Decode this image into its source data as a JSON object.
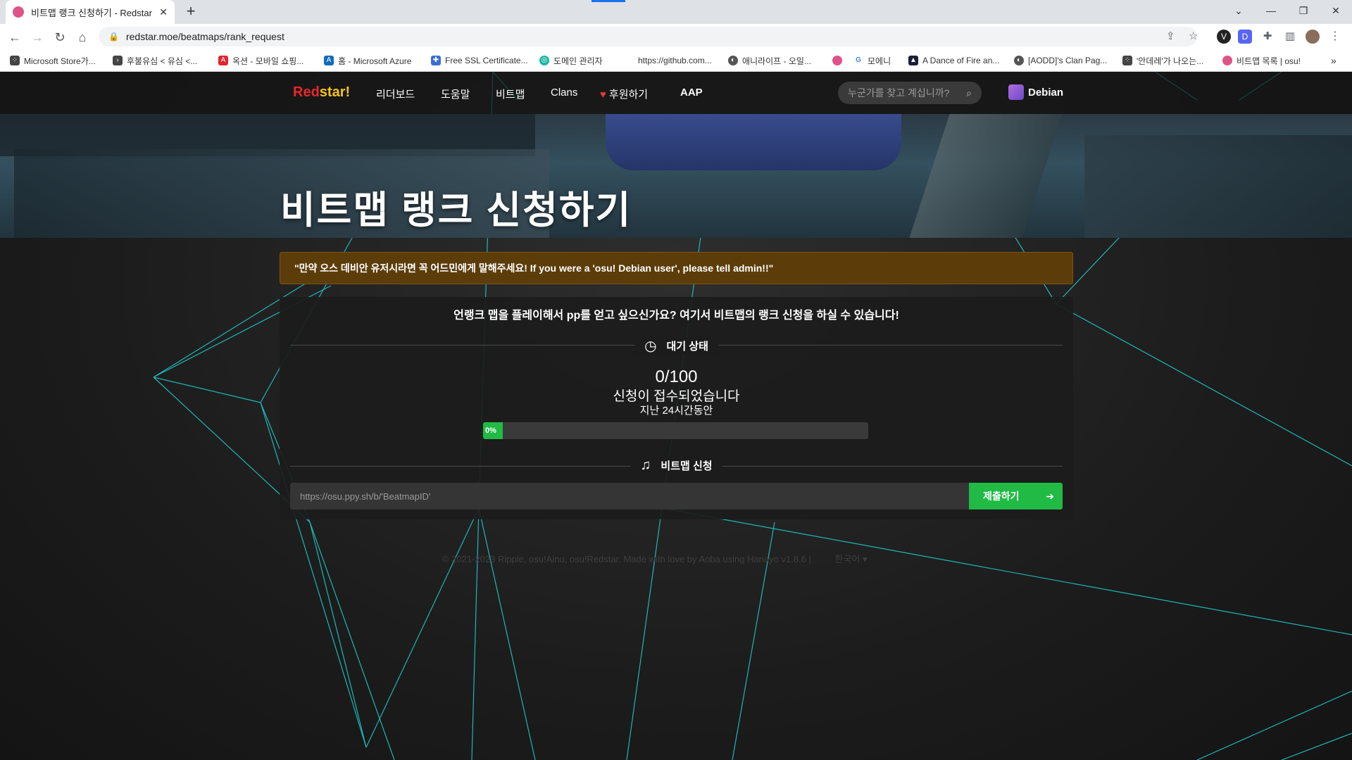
{
  "browser": {
    "tab_title": "비트맵 랭크 신청하기 - Redstar",
    "url": "redstar.moe/beatmaps/rank_request",
    "bookmarks": [
      {
        "label": "Microsoft Store가..."
      },
      {
        "label": "후불유심 < 유심 <..."
      },
      {
        "label": "옥션 - 모바일 쇼핑..."
      },
      {
        "label": "홈 - Microsoft Azure"
      },
      {
        "label": "Free SSL Certificate..."
      },
      {
        "label": "도메인 관리자"
      },
      {
        "label": "https://github.com..."
      },
      {
        "label": "애니라이프 - 오일..."
      },
      {
        "label": ""
      },
      {
        "label": "모에니"
      },
      {
        "label": "A Dance of Fire an..."
      },
      {
        "label": "[AODD]'s Clan Pag..."
      },
      {
        "label": "'안데레'가 나오는..."
      },
      {
        "label": "비트맵 목록 | osu!"
      }
    ]
  },
  "nav": {
    "brand_red": "Red",
    "brand_yellow": "star!",
    "links": [
      "리더보드",
      "도움말",
      "비트맵",
      "Clans",
      "후원하기",
      "AAP"
    ],
    "search_placeholder": "누군가를 찾고 계십니까?",
    "username": "Debian"
  },
  "hero": {
    "title": "비트맵 랭크 신청하기"
  },
  "notice": "\"만약 오스 데비안 유저시라면 꼭 어드민에게 말해주세요! If you were a 'osu! Debian user', please tell admin!!\"",
  "panel": {
    "lead": "언랭크 맵을 플레이해서 pp를 얻고 싶으신가요? 여기서 비트맵의 랭크 신청을 하실 수 있습니다!",
    "status_heading": "대기 상태",
    "count": "0/100",
    "received": "신청이 접수되었습니다",
    "period": "지난 24시간동안",
    "progress_label": "0%",
    "progress_fraction": 0,
    "request_heading": "비트맵 신청",
    "input_placeholder": "https://osu.ppy.sh/b/'BeatmapID'",
    "submit_label": "제출하기"
  },
  "footer": {
    "text": "© 2021-2023 Ripple, osu!Ainu, osu!Redstar. Made with love by Aoba using Hanayo v1.8.6 |",
    "language": "한국어"
  },
  "colors": {
    "accent_green": "#21ba45",
    "brand_red": "#e8272b",
    "brand_yellow": "#f5c518",
    "notice_bg": "#5c3d0a",
    "web_lines": "#1fc7c7"
  }
}
